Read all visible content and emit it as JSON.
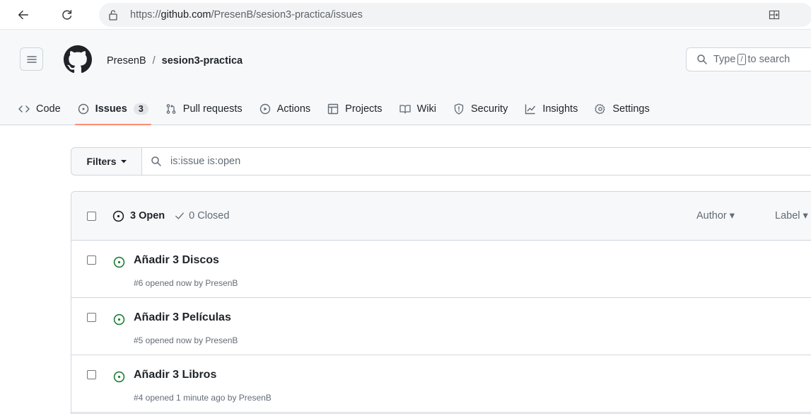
{
  "browser": {
    "url_prefix": "https://",
    "url_host": "github.com",
    "url_path": "/PresenB/sesion3-practica/issues"
  },
  "header": {
    "owner": "PresenB",
    "separator": "/",
    "repo": "sesion3-practica",
    "search_placeholder_start": "Type",
    "search_key": "/",
    "search_placeholder_end": "to search"
  },
  "tabs": [
    {
      "label": "Code",
      "icon": "code-icon"
    },
    {
      "label": "Issues",
      "icon": "issue-opened-icon",
      "count": "3"
    },
    {
      "label": "Pull requests",
      "icon": "git-pull-request-icon"
    },
    {
      "label": "Actions",
      "icon": "play-icon"
    },
    {
      "label": "Projects",
      "icon": "table-icon"
    },
    {
      "label": "Wiki",
      "icon": "book-icon"
    },
    {
      "label": "Security",
      "icon": "shield-icon"
    },
    {
      "label": "Insights",
      "icon": "graph-icon"
    },
    {
      "label": "Settings",
      "icon": "gear-icon"
    }
  ],
  "filters": {
    "button_label": "Filters",
    "query": "is:issue is:open"
  },
  "issues_header": {
    "open_label": "3 Open",
    "closed_label": "0 Closed",
    "author_label": "Author",
    "label_label": "Label"
  },
  "issues": [
    {
      "title": "Añadir 3 Discos",
      "meta": "#6 opened now by PresenB"
    },
    {
      "title": "Añadir 3 Películas",
      "meta": "#5 opened now by PresenB"
    },
    {
      "title": "Añadir 3 Libros",
      "meta": "#4 opened 1 minute ago by PresenB"
    }
  ],
  "colors": {
    "open_green": "#1a7f37",
    "active_tab_underline": "#fd8c73",
    "header_bg": "#f6f8fa",
    "border": "#d0d7de"
  }
}
